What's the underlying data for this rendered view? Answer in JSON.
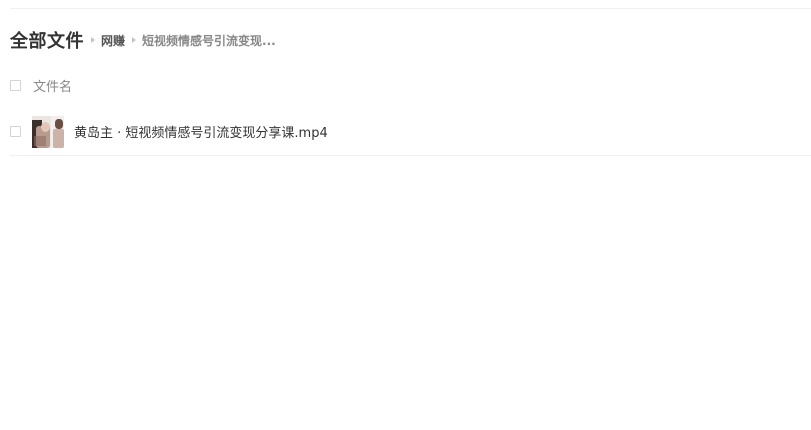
{
  "breadcrumb": {
    "root": "全部文件",
    "parent": "网赚",
    "current": "短视频情感号引流变现..."
  },
  "table": {
    "header": {
      "name_label": "文件名"
    },
    "rows": [
      {
        "name": "黄岛主 · 短视频情感号引流变现分享课.mp4",
        "icon": "video-thumbnail"
      }
    ]
  },
  "colors": {
    "text_primary": "#333333",
    "text_secondary": "#888888",
    "divider": "#f0f0f0"
  }
}
